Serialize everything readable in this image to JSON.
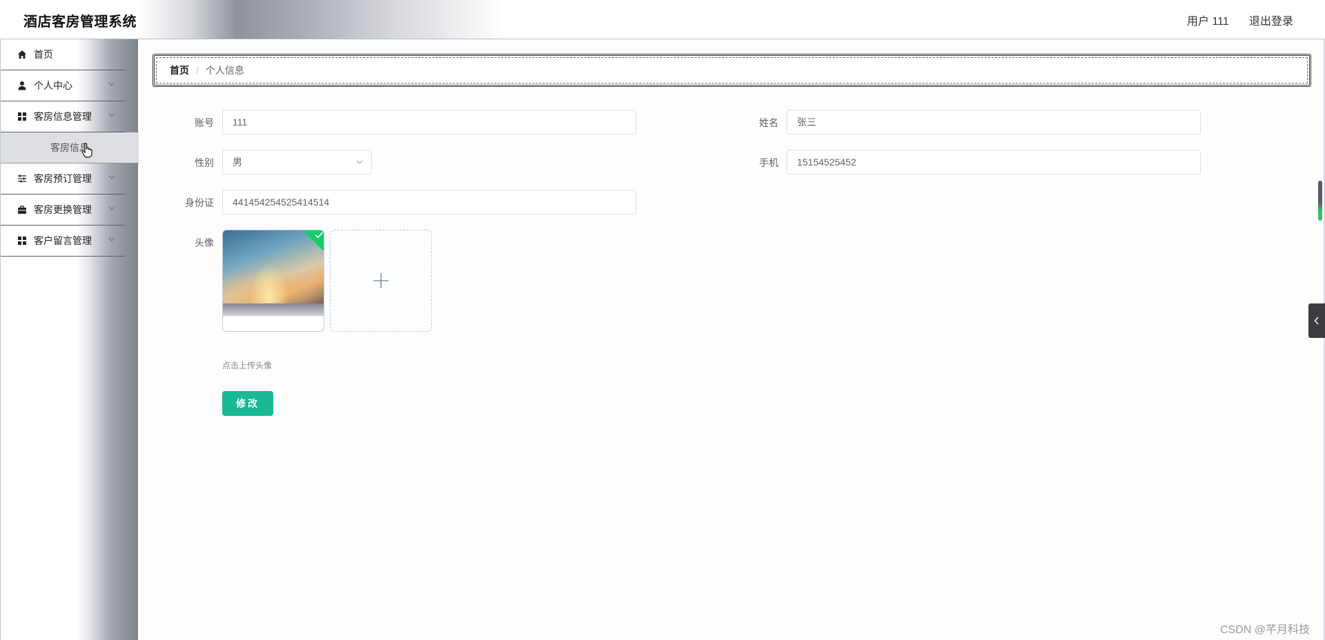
{
  "header": {
    "app_title": "酒店客房管理系统",
    "user_label": "用户 111",
    "logout_label": "退出登录"
  },
  "sidebar": {
    "items": [
      {
        "label": "首页",
        "icon": "home-icon"
      },
      {
        "label": "个人中心",
        "icon": "user-icon",
        "expandable": true
      },
      {
        "label": "客房信息管理",
        "icon": "grid-icon",
        "expandable": true,
        "expanded": true
      },
      {
        "label": "客房预订管理",
        "icon": "sliders-icon",
        "expandable": true
      },
      {
        "label": "客房更换管理",
        "icon": "briefcase-icon",
        "expandable": true
      },
      {
        "label": "客户留言管理",
        "icon": "grid-icon",
        "expandable": true
      }
    ],
    "submenu": {
      "label": "客房信息"
    }
  },
  "breadcrumb": {
    "home": "首页",
    "separator": "/",
    "current": "个人信息"
  },
  "form": {
    "account": {
      "label": "账号",
      "value": "111"
    },
    "name": {
      "label": "姓名",
      "value": "张三"
    },
    "gender": {
      "label": "性别",
      "value": "男"
    },
    "phone": {
      "label": "手机",
      "value": "15154525452"
    },
    "id_card": {
      "label": "身份证",
      "value": "441454254525414514"
    },
    "avatar": {
      "label": "头像",
      "tip": "点击上传头像",
      "upload_icon": "plus-icon"
    },
    "submit_label": "修改"
  },
  "colors": {
    "primary_button": "#18b993",
    "success_badge": "#13ce66"
  },
  "watermark": "CSDN @芊月科技"
}
